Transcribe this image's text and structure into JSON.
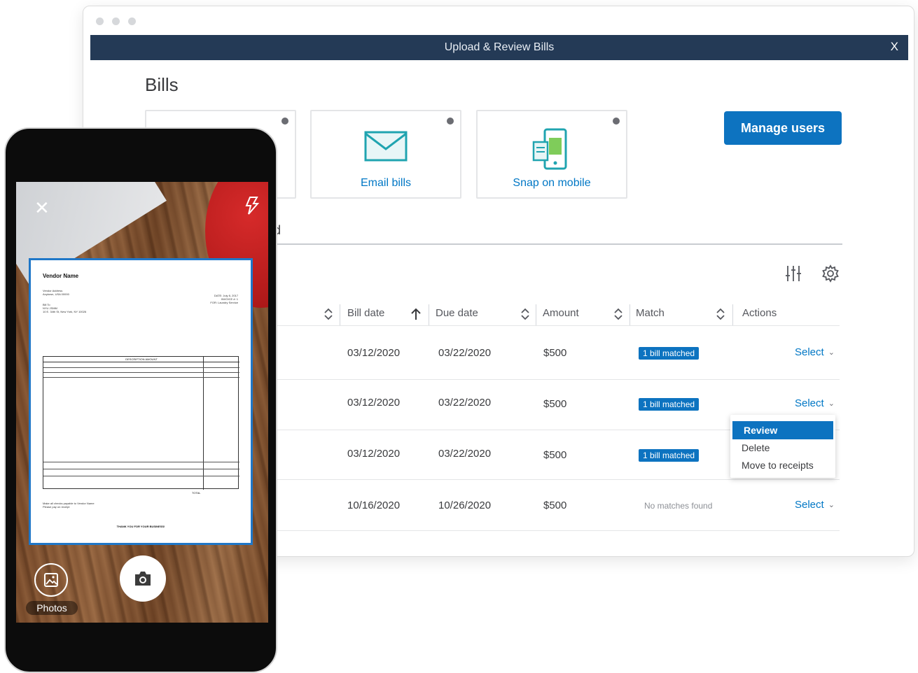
{
  "window": {
    "title": "Upload & Review Bills",
    "close_label": "X"
  },
  "page": {
    "heading": "Bills",
    "manage_users": "Manage users",
    "partial_tab_text": "d"
  },
  "cards": [
    {
      "label": "",
      "icon": "upload-icon"
    },
    {
      "label": "Email bills",
      "icon": "envelope-icon"
    },
    {
      "label": "Snap on mobile",
      "icon": "phone-receipt-icon"
    }
  ],
  "toolbar": {
    "icons": [
      "filter-sliders-icon",
      "gear-icon"
    ]
  },
  "table": {
    "headers": [
      "Bill date",
      "Due date",
      "Amount",
      "Match",
      "Actions"
    ],
    "rows": [
      {
        "bill_date": "03/12/2020",
        "due_date": "03/22/2020",
        "amount": "$500",
        "match": "1 bill matched",
        "action": "Select"
      },
      {
        "bill_date": "03/12/2020",
        "due_date": "03/22/2020",
        "amount": "$500",
        "match": "1 bill matched",
        "action": "Select"
      },
      {
        "bill_date": "03/12/2020",
        "due_date": "03/22/2020",
        "amount": "$500",
        "match": "1 bill matched",
        "action": ""
      },
      {
        "bill_date": "10/16/2020",
        "due_date": "10/26/2020",
        "amount": "$500",
        "match": "No matches found",
        "action": "Select"
      }
    ]
  },
  "dropdown": {
    "options": [
      "Review",
      "Delete",
      "Move to receipts"
    ],
    "highlighted": "Review"
  },
  "phone": {
    "photos_label": "Photos",
    "receipt": {
      "vendor": "Vendor Name",
      "address": "Vendor Address\nAnytown, USA 00000",
      "meta": "DATE: July 8, 2017\nINVOICE #: 1\nFOR: Laundry Service",
      "bill_to": "Bill To\nNYU JSMM\n10 E. 34th St, New York, NY 10026",
      "table_header": "DESCRIPTION          AMOUNT",
      "total_label": "TOTAL",
      "footer": "Make all checks payable to Vendor Name\nPlease pay on receipt",
      "thanks": "THANK YOU FOR YOUR BUSINESS!"
    }
  },
  "colors": {
    "titlebar": "#243a56",
    "brand_blue": "#0d73c0",
    "link_blue": "#0077c5"
  }
}
